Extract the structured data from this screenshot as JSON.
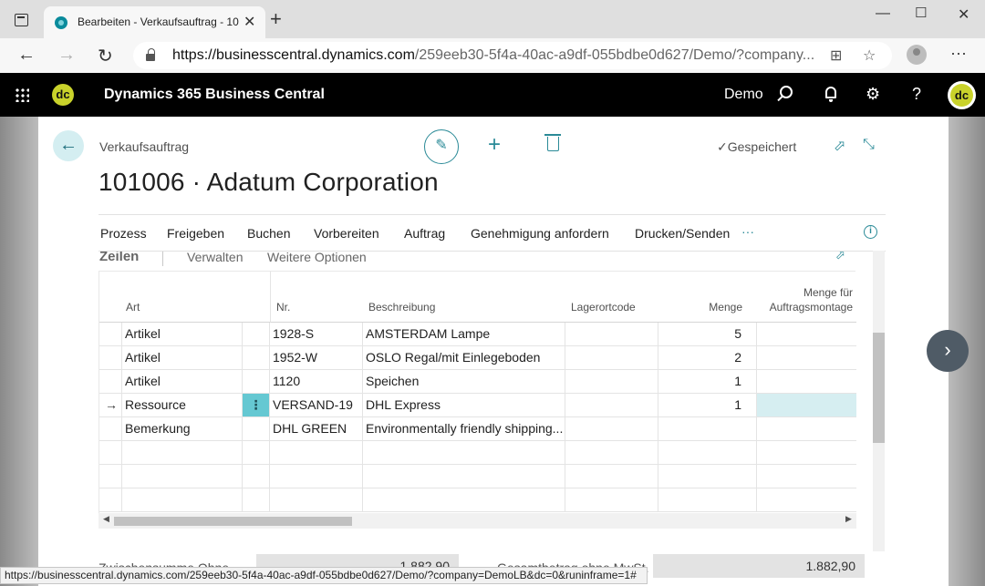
{
  "browser": {
    "tab_title": "Bearbeiten - Verkaufsauftrag - 10",
    "url_host": "https://businesscentral.dynamics.com",
    "url_path": "/259eeb30-5f4a-40ac-a9df-055bdbe0d627/Demo/?company..."
  },
  "app": {
    "title": "Dynamics 365 Business Central",
    "logo_text": "dc",
    "company": "Demo",
    "avatar_text": "dc"
  },
  "page": {
    "breadcrumb": "Verkaufsauftrag",
    "title": "101006 · Adatum Corporation",
    "saved_label": "Gespeichert"
  },
  "actions": [
    "Prozess",
    "Freigeben",
    "Buchen",
    "Vorbereiten",
    "Auftrag",
    "Genehmigung anfordern",
    "Drucken/Senden",
    "···"
  ],
  "lines_section": {
    "title": "Zeilen",
    "menu": [
      "Verwalten",
      "Weitere Optionen"
    ]
  },
  "grid": {
    "headers": {
      "art": "Art",
      "nr": "Nr.",
      "beschreibung": "Beschreibung",
      "lagerortcode": "Lagerortcode",
      "menge": "Menge",
      "menge_montage": "Menge für Auftragsmontage"
    },
    "rows": [
      {
        "art": "Artikel",
        "nr": "1928-S",
        "beschreibung": "AMSTERDAM Lampe",
        "lagerortcode": "",
        "menge": "5",
        "current": false
      },
      {
        "art": "Artikel",
        "nr": "1952-W",
        "beschreibung": "OSLO Regal/mit Einlegeboden",
        "lagerortcode": "",
        "menge": "2",
        "current": false
      },
      {
        "art": "Artikel",
        "nr": "1120",
        "beschreibung": "Speichen",
        "lagerortcode": "",
        "menge": "1",
        "current": false
      },
      {
        "art": "Ressource",
        "nr": "VERSAND-19",
        "beschreibung": "DHL Express",
        "lagerortcode": "",
        "menge": "1",
        "current": true
      },
      {
        "art": "Bemerkung",
        "nr": "DHL GREEN",
        "beschreibung": "Environmentally friendly shipping...",
        "lagerortcode": "",
        "menge": "",
        "current": false
      }
    ]
  },
  "totals": {
    "label_left": "Zwischensumme Ohne...",
    "value_left": "1.882,90",
    "label_right": "Gesamtbetrag ohne MwSt.",
    "value_right": "1.882,90"
  },
  "status_url": "https://businesscentral.dynamics.com/259eeb30-5f4a-40ac-a9df-055bdbe0d627/Demo/?company=DemoLB&dc=0&runinframe=1#"
}
